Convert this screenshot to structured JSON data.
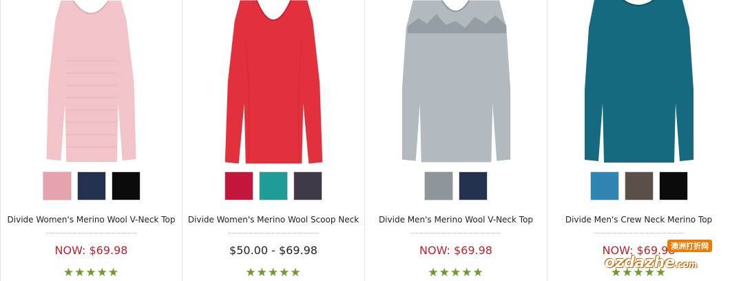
{
  "products": [
    {
      "name": "Divide Women's Merino Wool V-Neck Top",
      "price": "NOW: $69.98",
      "sale": true,
      "rating": "★★★★★",
      "shirt_color": "#f2c4ca",
      "swatches": [
        "#e6a3ad",
        "#25324f",
        "#0b0b0b"
      ]
    },
    {
      "name": "Divide Women's Merino Wool Scoop Neck",
      "price": "$50.00 - $69.98",
      "sale": false,
      "rating": "★★★★★",
      "shirt_color": "#e3303d",
      "swatches": [
        "#c0173a",
        "#1f9c98",
        "#403a48"
      ]
    },
    {
      "name": "Divide Men's Merino Wool V-Neck Top",
      "price": "NOW: $69.98",
      "sale": true,
      "rating": "★★★★★",
      "shirt_color": "#b2bac0",
      "swatches": [
        "#8e969b",
        "#25324f"
      ]
    },
    {
      "name": "Divide Men's Crew Neck Merino Top",
      "price": "NOW: $69.98",
      "sale": true,
      "rating": "★★★★★",
      "shirt_color": "#166a80",
      "swatches": [
        "#2f84b2",
        "#5b5048",
        "#0b0b0b"
      ]
    }
  ],
  "watermark": {
    "badge": "澳洲打折网",
    "brand": "ozdazhe",
    "domain": ".com"
  }
}
